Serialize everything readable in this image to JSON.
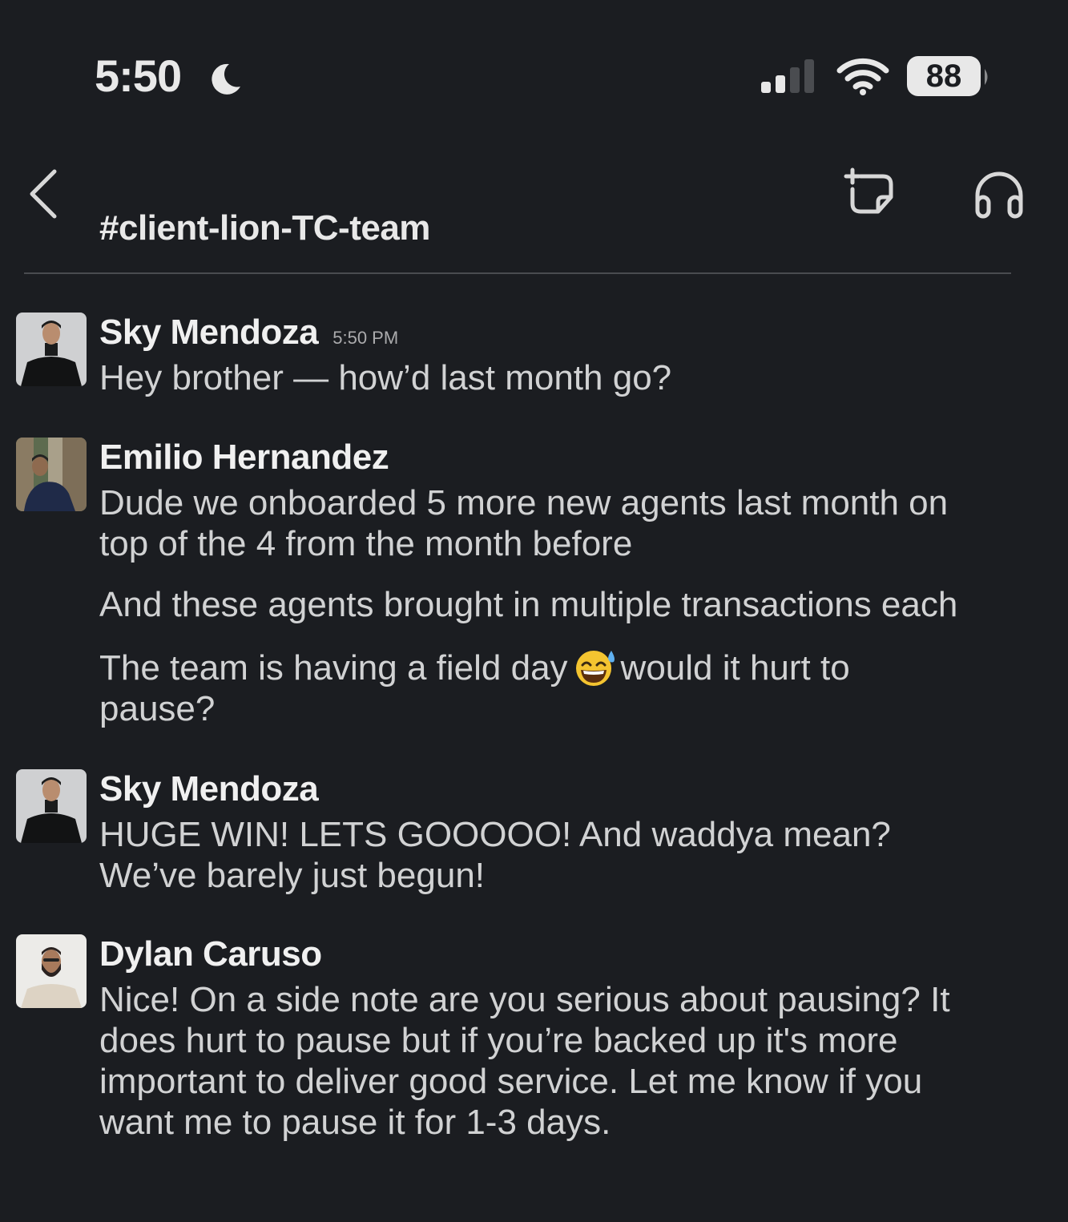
{
  "status_bar": {
    "time": "5:50",
    "battery": "88"
  },
  "header": {
    "channel_name": "#client-lion-TC-team"
  },
  "messages": [
    {
      "author": "Sky Mendoza",
      "timestamp": "5:50 PM",
      "lines": [
        "Hey brother — how’d last month go?"
      ]
    },
    {
      "author": "Emilio Hernandez",
      "lines": [
        "Dude we onboarded 5 more new agents last month on",
        "top of the 4 from the month before",
        "And these agents brought in multiple transactions each",
        "The team is having a field day",
        "would it hurt to",
        "pause?"
      ]
    },
    {
      "author": "Sky Mendoza",
      "lines": [
        "HUGE WIN! LETS GOOOOO! And waddya mean?",
        "We’ve barely just begun!"
      ]
    },
    {
      "author": "Dylan Caruso",
      "lines": [
        "Nice! On a side note are you serious about pausing? It",
        "does hurt to pause but if you’re backed up it's more",
        "important to deliver good service. Let me know if you",
        "want me to pause it for 1-3 days."
      ]
    }
  ],
  "icons": {
    "back": "chevron-left-icon",
    "canvas": "canvas-icon",
    "huddle": "headphones-icon",
    "moon": "moon-icon",
    "signal": "cellular-signal-icon",
    "wifi": "wifi-icon",
    "emoji": "sweat-smile-emoji"
  }
}
